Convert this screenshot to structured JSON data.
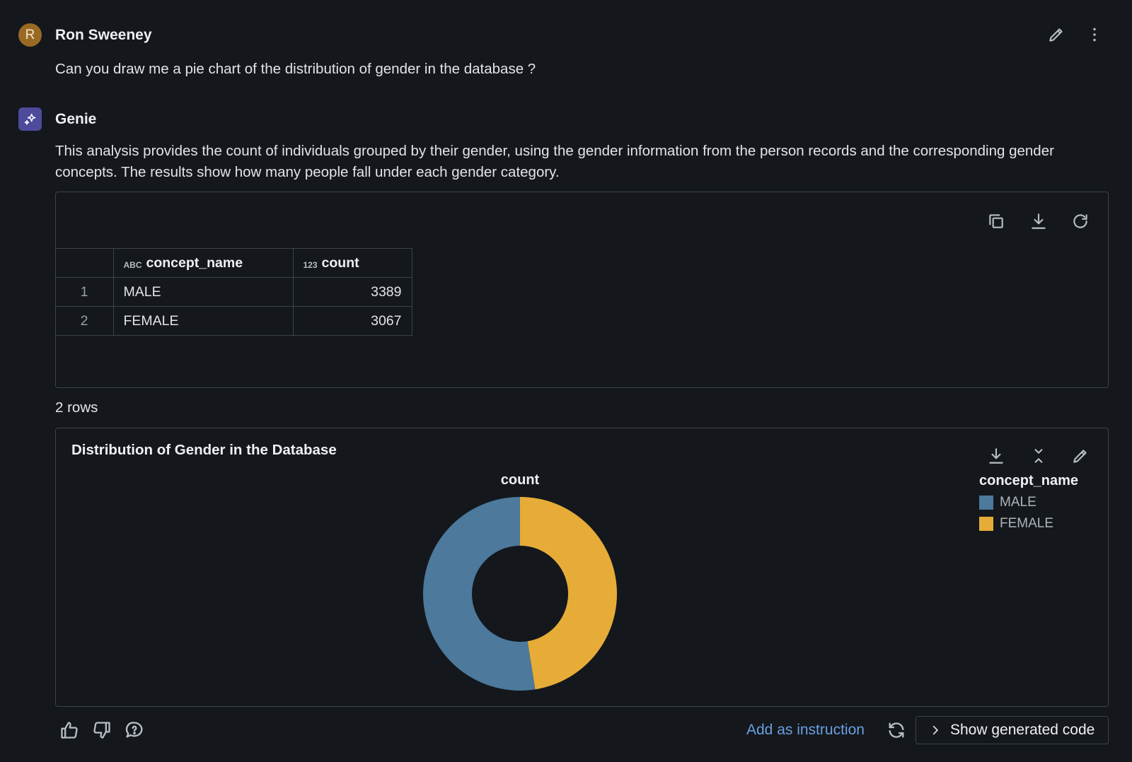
{
  "user_message": {
    "avatar_initial": "R",
    "author": "Ron Sweeney",
    "text": "Can you draw me a pie chart of the distribution of gender in the database ?"
  },
  "genie_message": {
    "author": "Genie",
    "text": "This analysis provides the count of individuals grouped by their gender, using the gender information from the person records and the corresponding gender concepts. The results show how many people fall under each gender category."
  },
  "table": {
    "columns": [
      {
        "type_glyph": "ABC",
        "name": "concept_name"
      },
      {
        "type_glyph": "123",
        "name": "count"
      }
    ],
    "rows": [
      {
        "index": "1",
        "concept_name": "MALE",
        "count": "3389"
      },
      {
        "index": "2",
        "concept_name": "FEMALE",
        "count": "3067"
      }
    ],
    "row_count_label": "2 rows"
  },
  "chart_data": {
    "type": "pie",
    "title": "Distribution of Gender in the Database",
    "series_title": "count",
    "legend_title": "concept_name",
    "legend_position": "top-right",
    "donut": true,
    "categories": [
      "MALE",
      "FEMALE"
    ],
    "values": [
      3389,
      3067
    ],
    "colors": [
      "#4c799c",
      "#e6ac37"
    ]
  },
  "footer": {
    "add_instruction_label": "Add as instruction",
    "show_code_label": "Show generated code"
  },
  "colors": {
    "background": "#14171c",
    "accent_link": "#6aa0e0",
    "user_avatar": "#9a6a24",
    "genie_avatar": "#4e4a9c"
  }
}
